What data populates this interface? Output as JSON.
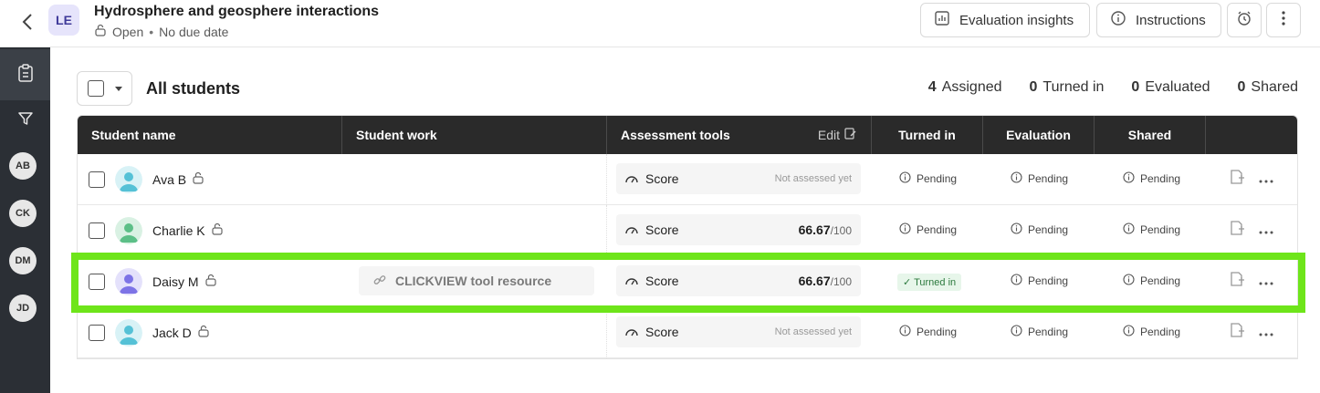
{
  "header": {
    "avatar_initials": "LE",
    "title": "Hydrosphere and geosphere interactions",
    "status": "Open",
    "due": "No due date",
    "buttons": {
      "insights": "Evaluation insights",
      "instructions": "Instructions"
    }
  },
  "sidebar": {
    "avatars": [
      "AB",
      "CK",
      "DM",
      "JD"
    ]
  },
  "toolbar": {
    "title": "All students",
    "stats": [
      {
        "count": "4",
        "label": "Assigned"
      },
      {
        "count": "0",
        "label": "Turned in"
      },
      {
        "count": "0",
        "label": "Evaluated"
      },
      {
        "count": "0",
        "label": "Shared"
      }
    ]
  },
  "table": {
    "columns": {
      "student": "Student name",
      "work": "Student work",
      "assessment": "Assessment tools",
      "edit": "Edit",
      "turned_in": "Turned in",
      "evaluation": "Evaluation",
      "shared": "Shared"
    },
    "rows": [
      {
        "name": "Ava B",
        "work": "",
        "score_label": "Score",
        "score": "",
        "score_den": "",
        "not_assessed": "Not assessed yet",
        "turned_in": "Pending",
        "evaluation": "Pending",
        "shared": "Pending",
        "avatar_color": "#55c1d6"
      },
      {
        "name": "Charlie K",
        "work": "",
        "score_label": "Score",
        "score": "66.67",
        "score_den": "/100",
        "not_assessed": "",
        "turned_in": "Pending",
        "evaluation": "Pending",
        "shared": "Pending",
        "avatar_color": "#5cbf87"
      },
      {
        "name": "Daisy M",
        "work": "CLICKVIEW tool resource",
        "score_label": "Score",
        "score": "66.67",
        "score_den": "/100",
        "not_assessed": "",
        "turned_in": "Turned in",
        "evaluation": "Pending",
        "shared": "Pending",
        "avatar_color": "#7d73e6"
      },
      {
        "name": "Jack D",
        "work": "",
        "score_label": "Score",
        "score": "",
        "score_den": "",
        "not_assessed": "Not assessed yet",
        "turned_in": "Pending",
        "evaluation": "Pending",
        "shared": "Pending",
        "avatar_color": "#55c1d6"
      }
    ]
  },
  "colors": {
    "highlight": "#6ee51a",
    "header_dark": "#2a2a2a",
    "sidebar": "#2b2f35"
  }
}
